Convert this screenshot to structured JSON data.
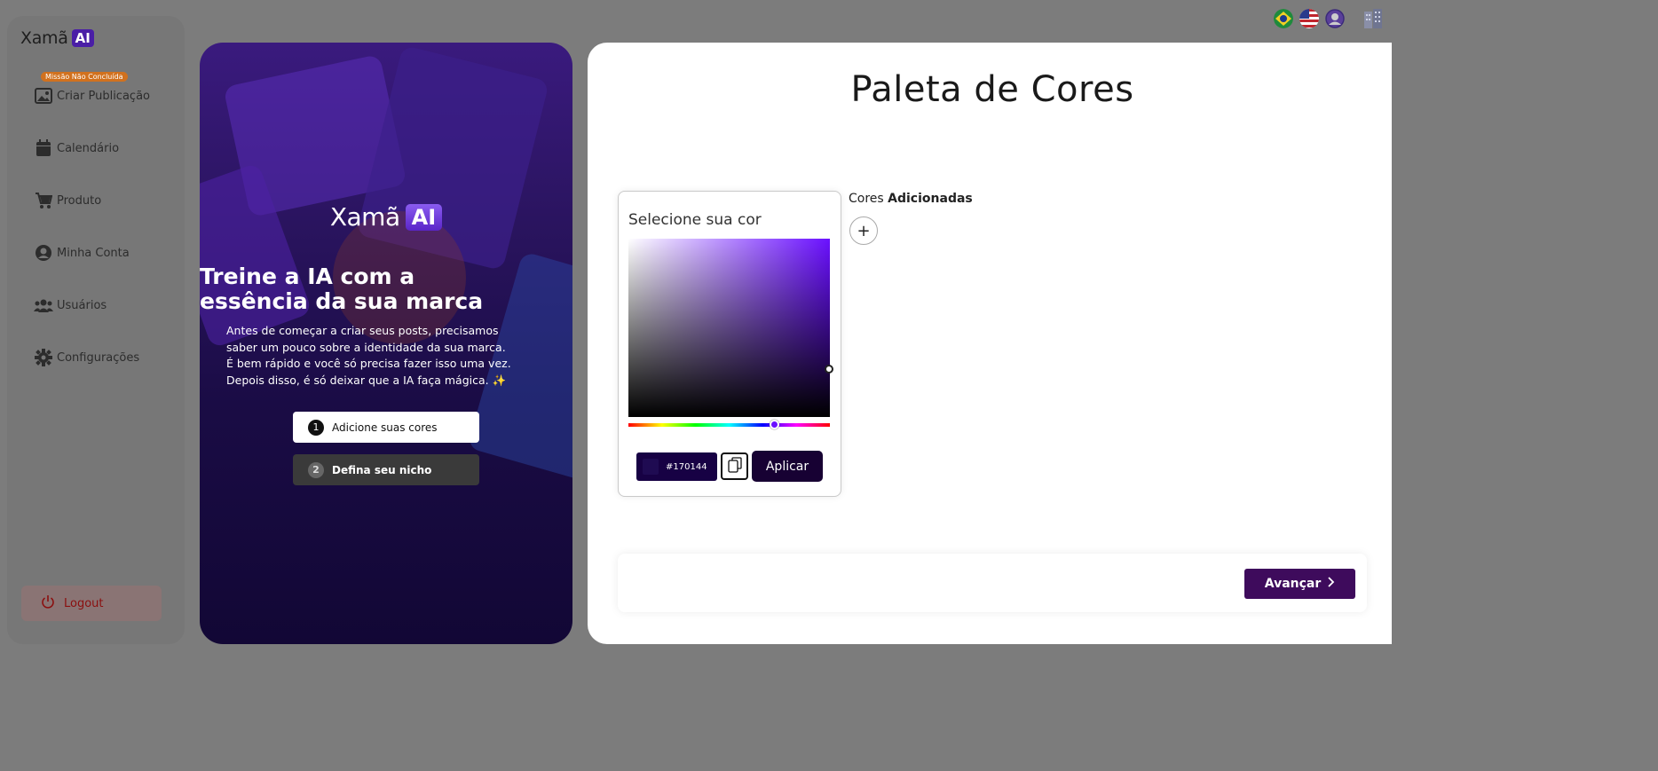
{
  "brand": {
    "name": "Xamã",
    "ai": "AI"
  },
  "sidebar": {
    "badge": "Missão Não Concluída",
    "items": [
      {
        "label": "Criar Publicação",
        "icon": "image-icon"
      },
      {
        "label": "Calendário",
        "icon": "calendar-icon"
      },
      {
        "label": "Produto",
        "icon": "cart-icon"
      },
      {
        "label": "Minha Conta",
        "icon": "account-icon"
      },
      {
        "label": "Usuários",
        "icon": "users-icon"
      },
      {
        "label": "Configurações",
        "icon": "gear-icon"
      }
    ],
    "logout": "Logout"
  },
  "hero": {
    "title_line1": "Treine a IA com a",
    "title_line2": "essência da sua marca",
    "desc_line1": "Antes de começar a criar seus posts, precisamos",
    "desc_line2": "saber um pouco sobre a identidade da sua marca.",
    "desc_line3": "É bem rápido e você só precisa fazer isso uma vez.",
    "desc_line4": "Depois disso, é só deixar que a IA faça mágica. ✨",
    "steps": [
      {
        "num": "1",
        "label": "Adicione suas cores"
      },
      {
        "num": "2",
        "label": "Defina seu nicho"
      }
    ]
  },
  "panel": {
    "title": "Paleta de Cores",
    "picker_title": "Selecione sua cor",
    "hex_value": "#170144",
    "apply": "Aplicar",
    "added_prefix": "Cores",
    "added_bold": "Adicionadas",
    "add_symbol": "+",
    "next": "Avançar"
  },
  "colors": {
    "accent": "#3e0b5c",
    "selected": "#170144",
    "hue": "#6a10ff"
  }
}
